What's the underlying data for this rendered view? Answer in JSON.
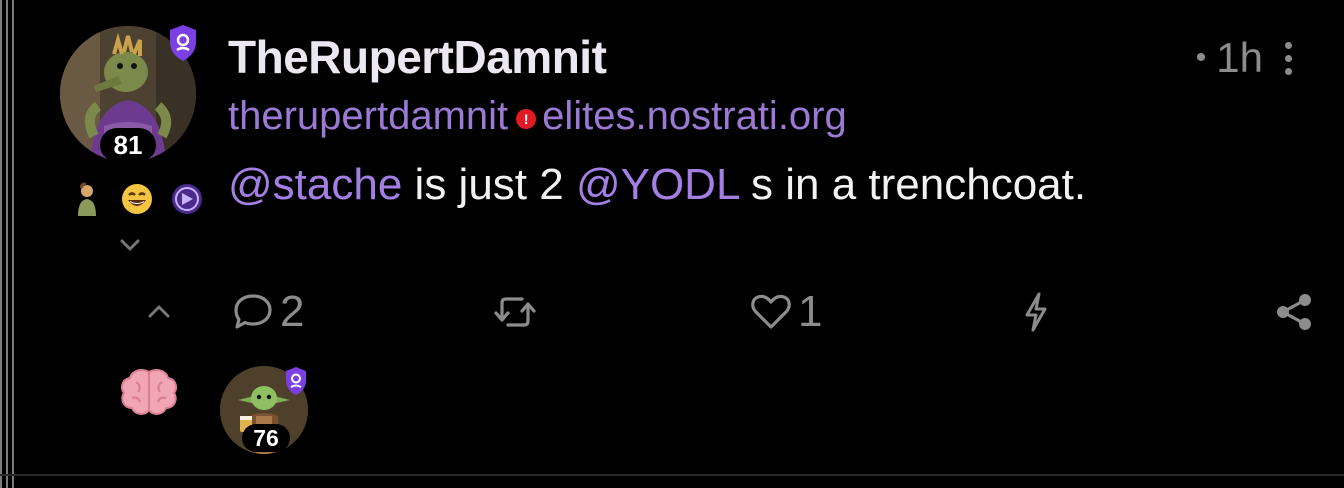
{
  "post": {
    "author_name": "TheRupertDamnit",
    "handle_user": "therupertdamnit",
    "handle_warning": "!",
    "handle_domain": "elites.nostrati.org",
    "time_bullet": "•",
    "time_ago": "1h",
    "avatar_score": "81",
    "content_mention_1": "@stache",
    "content_text_1": " is just 2 ",
    "content_mention_2": "@YODL",
    "content_text_2": " s in a trenchcoat."
  },
  "actions": {
    "reply_count": "2",
    "like_count": "1"
  },
  "replies": {
    "reply_score": "76"
  },
  "colors": {
    "background": "#000000",
    "accent_purple": "#9b7ad6",
    "mention_purple": "#a47fe3",
    "muted": "#8c8c8c",
    "badge_purple": "#7b3fe4",
    "warning_red": "#e01b24"
  },
  "icons": [
    "shield-badge-icon",
    "warning-icon",
    "kebab-menu-icon",
    "chevron-down-icon",
    "chevron-up-icon",
    "reply-icon",
    "repost-icon",
    "heart-icon",
    "zap-icon",
    "share-icon",
    "brain-icon"
  ]
}
